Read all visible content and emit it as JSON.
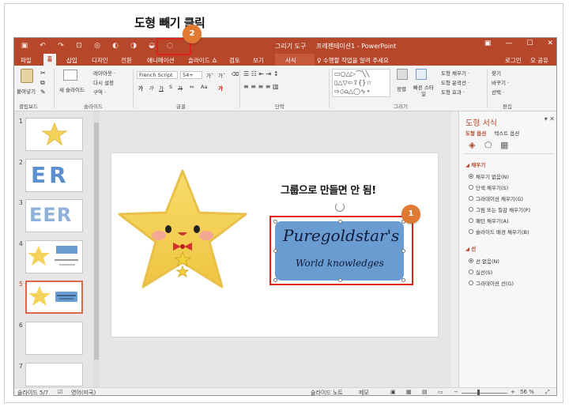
{
  "annotations": {
    "top_caption": "도형 빼기 클릭",
    "slide_note": "그룹으로 만들면 안 됨!",
    "badge1": "1",
    "badge2": "2"
  },
  "titlebar": {
    "context_tool": "그리기 도구",
    "title": "프레젠테이션1 - PowerPoint"
  },
  "tabs": {
    "file": "파일",
    "home": "홈",
    "insert": "삽입",
    "design": "디자인",
    "transitions": "전환",
    "animations": "애니메이션",
    "slideshow": "슬라이드 쇼",
    "review": "검토",
    "view": "보기",
    "format": "서식",
    "tell_me": "♀ 수행할 작업을 알려 주세요",
    "login": "로그인",
    "share": "오 공유"
  },
  "ribbon": {
    "paste": "붙여넣기",
    "new_slide": "새 슬라이드",
    "layout": "레이아웃 ·",
    "reset": "다시 설정",
    "section": "구역 ·",
    "font_name": "French Script",
    "font_size": "54+",
    "arrange": "정렬",
    "quick_styles": "빠른 스타일",
    "shape_fill": "도형 채우기 ·",
    "shape_outline": "도형 윤곽선 ·",
    "shape_effects": "도형 효과 ·",
    "find": "찾기",
    "replace": "바꾸기 ·",
    "select": "선택 ·",
    "groups": {
      "clipboard": "클립보드",
      "slides": "슬라이드",
      "font": "글꼴",
      "paragraph": "단락",
      "drawing": "그리기",
      "editing": "편집"
    }
  },
  "thumbnails": {
    "numbers": [
      "1",
      "2",
      "3",
      "4",
      "5",
      "6",
      "7"
    ],
    "thumb2_text": "ER",
    "thumb3_text": "EER"
  },
  "slide": {
    "card_line1": "Puregoldstar's",
    "card_line2": "World knowledges"
  },
  "format_pane": {
    "title": "도형 서식",
    "tab_shape": "도형 옵션",
    "tab_text": "텍스트 옵션",
    "fill_section": "◢ 채우기",
    "fill_options": [
      "채우기 없음(N)",
      "단색 채우기(S)",
      "그라데이션 채우기(G)",
      "그림 또는 질감 채우기(P)",
      "패턴 채우기(A)",
      "슬라이드 배경 채우기(B)"
    ],
    "line_section": "◢ 선",
    "line_options": [
      "선 없음(N)",
      "실선(S)",
      "그라데이션 선(G)"
    ]
  },
  "status": {
    "slide_pos": "슬라이드 5/7",
    "language": "영어(미국)",
    "notes": "슬라이드 노트",
    "comments": "메모",
    "zoom": "56 %"
  },
  "colors": {
    "accent": "#b7472a",
    "highlight_box": "#e0201b",
    "badge": "#e07a32",
    "card": "#6a9bd1",
    "star": "#f5d35a"
  }
}
